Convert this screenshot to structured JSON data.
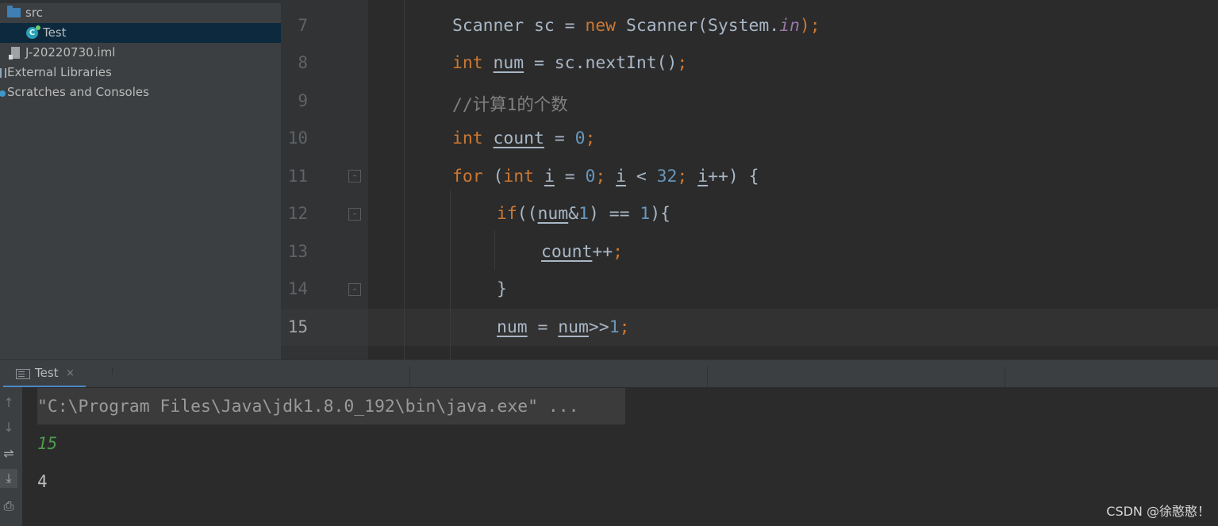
{
  "project_tree": {
    "items": [
      {
        "label": "src",
        "icon": "folder-icon"
      },
      {
        "label": "Test",
        "icon": "java-class-icon",
        "selected": true
      },
      {
        "label": "J-20220730.iml",
        "icon": "module-file-icon"
      },
      {
        "label": "External Libraries",
        "icon": "libraries-icon"
      },
      {
        "label": "Scratches and Consoles",
        "icon": "scratches-icon"
      }
    ]
  },
  "editor": {
    "line_numbers": [
      "7",
      "8",
      "9",
      "10",
      "11",
      "12",
      "13",
      "14",
      "15"
    ],
    "current_line": "15",
    "lines": {
      "l7": {
        "a": "Scanner sc = ",
        "b": "new",
        "c": " Scanner(System.",
        "d": "in",
        "e": ");"
      },
      "l8": {
        "a": "int",
        "b": " ",
        "c": "num",
        "d": " = sc.nextInt()",
        "e": ";"
      },
      "l9": {
        "a": "//计算1的个数"
      },
      "l10": {
        "a": "int",
        "b": " ",
        "c": "count",
        "d": " = ",
        "e": "0",
        "f": ";"
      },
      "l11": {
        "a": "for",
        "b": " (",
        "c": "int",
        "d": " ",
        "e": "i",
        "f": " = ",
        "g": "0",
        "h": "; ",
        "i": "i",
        "j": " < ",
        "k": "32",
        "l": "; ",
        "m": "i",
        "n": "++) {"
      },
      "l12": {
        "a": "if",
        "b": "((",
        "c": "num",
        "d": "&",
        "e": "1",
        "f": ") == ",
        "g": "1",
        "h": "){"
      },
      "l13": {
        "a": "count",
        "b": "++",
        "c": ";"
      },
      "l14": {
        "a": "}"
      },
      "l15": {
        "a": "num",
        "b": " = ",
        "c": "num",
        "d": ">>",
        "e": "1",
        "f": ";"
      }
    }
  },
  "run_window": {
    "tab_label": "Test",
    "tab_close": "×",
    "command": "\"C:\\Program Files\\Java\\jdk1.8.0_192\\bin\\java.exe\" ...",
    "output": [
      {
        "text": "15",
        "kind": "user-input"
      },
      {
        "text": "4",
        "kind": "stdout"
      }
    ],
    "toolbar": [
      "up-arrow-icon",
      "down-arrow-icon",
      "soft-wrap-icon",
      "scroll-to-end-icon",
      "print-icon"
    ]
  },
  "watermark": "CSDN @徐憨憨！",
  "colors": {
    "keyword": "#cc7832",
    "number": "#6897bb",
    "static_field": "#9876aa",
    "comment": "#808080",
    "default_text": "#a9b7c6",
    "selection": "#0d293e",
    "user_input": "#4e9a4e"
  }
}
